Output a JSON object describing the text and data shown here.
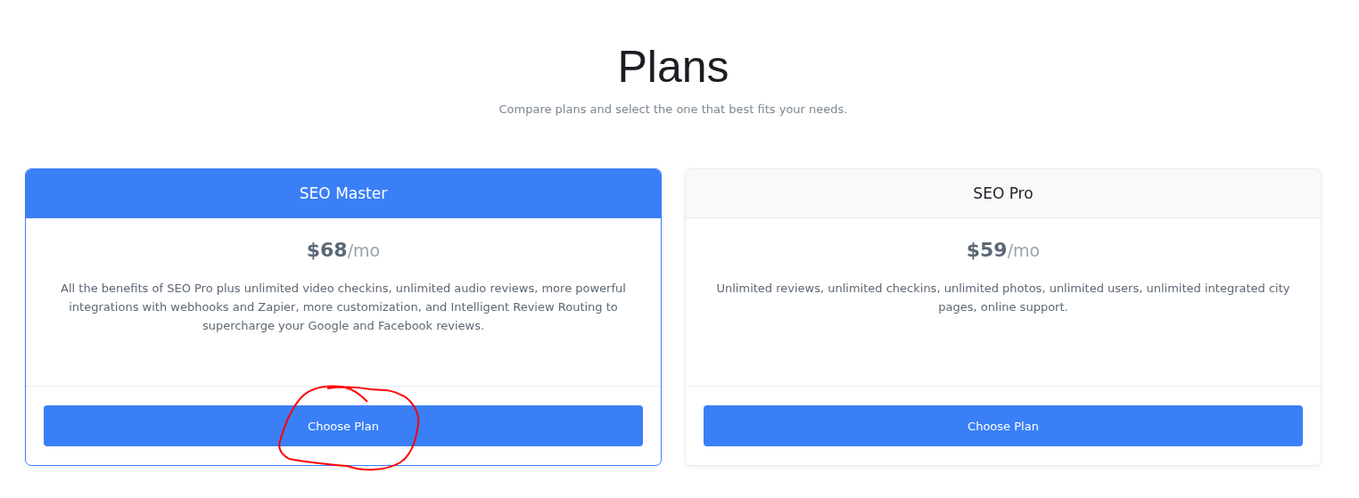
{
  "heading": {
    "title": "Plans",
    "subtitle": "Compare plans and select the one that best fits your needs."
  },
  "plans": [
    {
      "name": "SEO Master",
      "selected": true,
      "price": "$68",
      "period": "/mo",
      "description": "All the benefits of SEO Pro plus unlimited video checkins, unlimited audio reviews, more powerful integrations with webhooks and Zapier, more customization, and Intelligent Review Routing to supercharge your Google and Facebook reviews.",
      "button": "Choose Plan",
      "circled": true
    },
    {
      "name": "SEO Pro",
      "selected": false,
      "price": "$59",
      "period": "/mo",
      "description": "Unlimited reviews, unlimited checkins, unlimited photos, unlimited users, unlimited integrated city pages, online support.",
      "button": "Choose Plan",
      "circled": false
    }
  ]
}
